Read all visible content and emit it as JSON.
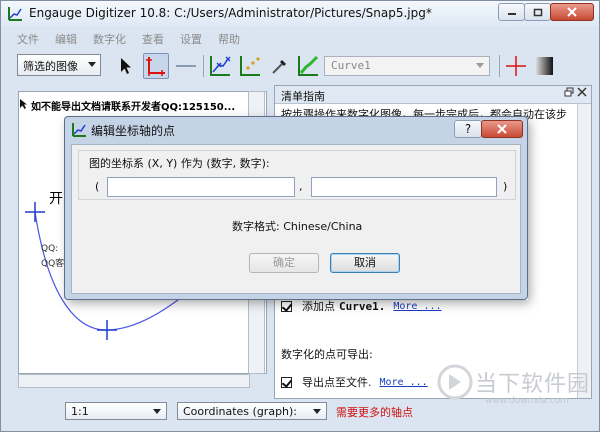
{
  "window": {
    "title": "Engauge Digitizer 10.8: C:/Users/Administrator/Pictures/Snap5.jpg*"
  },
  "menu": [
    "文件",
    "编辑",
    "数字化",
    "查看",
    "设置",
    "帮助"
  ],
  "toolbar": {
    "background_filter": "筛选的图像",
    "curve_select": "Curve1",
    "icons": [
      "select-arrow-icon",
      "axis-point-icon",
      "scale-bar-icon",
      "curve-point-icon",
      "point-match-icon",
      "color-picker-icon",
      "segment-fill-icon",
      "crosshair-icon",
      "gradient-icon"
    ]
  },
  "canvas": {
    "top_text": "如不能导出文档请联系开发者QQ:125150...",
    "big_text": "开",
    "small_lines": [
      "QQ:",
      "QQ客"
    ]
  },
  "checklist": {
    "title": "清单指南",
    "intro": "按步骤操作来数字化图像。每一步完成后，都会自动在该步",
    "add_point_prefix": "添加点",
    "add_point_curve": "Curve1.",
    "add_point_more": "More ...",
    "exportable_heading": "数字化的点可导出:",
    "export_label": "导出点至文件.",
    "export_more": "More ..."
  },
  "status": {
    "zoom": "1:1",
    "coordinates": "Coordinates (graph):",
    "message": "需要更多的轴点"
  },
  "watermark": {
    "text": "当下软件园",
    "url": "www.downxia.com"
  },
  "dialog": {
    "title": "编辑坐标轴的点",
    "help_label": "?",
    "group_label": "图的坐标系 (X, Y) 作为 (数字, 数字):",
    "open_paren": "(",
    "comma": ",",
    "close_paren": ")",
    "x_value": "",
    "y_value": "",
    "number_format": "数字格式: Chinese/China",
    "ok_label": "确定",
    "cancel_label": "取消"
  },
  "colors": {
    "accent_blue": "#1f3fd0",
    "curve_line": "#4a57e0",
    "status_red": "#d01010"
  }
}
